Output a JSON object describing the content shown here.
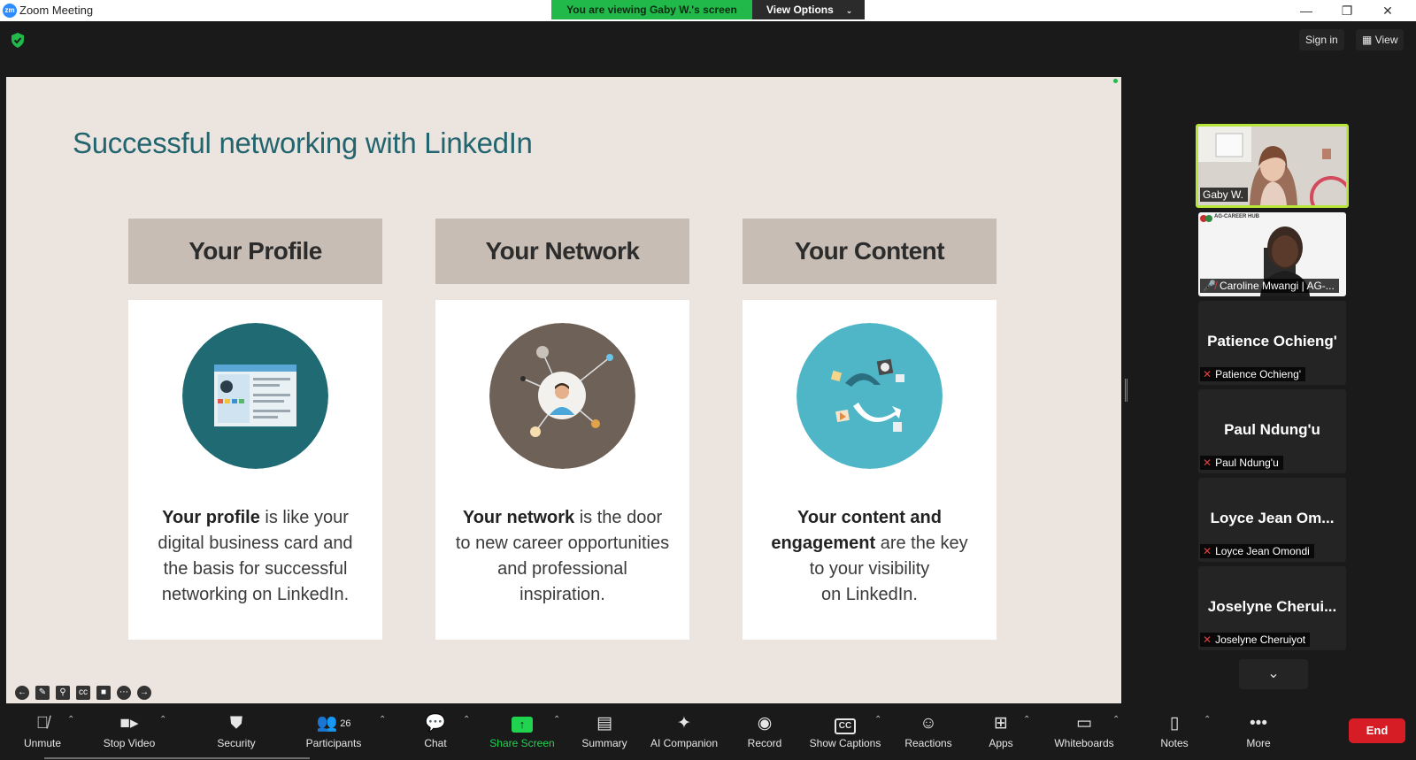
{
  "window": {
    "title": "Zoom Meeting",
    "logo_text": "zm",
    "controls": [
      "—",
      "❐",
      "✕"
    ]
  },
  "banner": {
    "viewing": "You are viewing Gaby W.'s screen",
    "options": "View Options"
  },
  "top": {
    "sign_in": "Sign in",
    "view": "View"
  },
  "slide": {
    "title": "Successful networking with LinkedIn",
    "columns": [
      {
        "header": "Your Profile",
        "bold": "Your profile",
        "rest_1": " is like your",
        "line2": "digital business card and",
        "line3": "the basis for successful",
        "line4": "networking on LinkedIn.",
        "circle_color": "#1f6a73"
      },
      {
        "header": "Your Network",
        "bold": "Your network",
        "rest_1": " is the door",
        "line2": "to new career opportunities",
        "line3": "and professional",
        "line4": "inspiration.",
        "circle_color": "#6e6157"
      },
      {
        "header": "Your Content",
        "bold_a": "Your content and",
        "bold_b": "engagement",
        "rest_b": " are the key",
        "line3": "to your visibility",
        "line4": "on LinkedIn.",
        "circle_color": "#4fb6c8"
      }
    ]
  },
  "gallery": {
    "tiles": [
      {
        "label": "Gaby W.",
        "video": true,
        "active": true
      },
      {
        "label": "Caroline Mwangi | AG-...",
        "video": true,
        "muted": true,
        "org_text": "AG-CAREER HUB"
      },
      {
        "center": "Patience Ochieng'",
        "label": "Patience Ochieng'",
        "muted": true
      },
      {
        "center": "Paul Ndung'u",
        "label": "Paul Ndung'u",
        "muted": true
      },
      {
        "center": "Loyce Jean Om...",
        "label": "Loyce Jean Omondi",
        "muted": true
      },
      {
        "center": "Joselyne Cherui...",
        "label": "Joselyne Cheruiyot",
        "muted": true
      }
    ]
  },
  "toolbar": {
    "unmute": "Unmute",
    "stop_video": "Stop Video",
    "security": "Security",
    "participants": "Participants",
    "participants_count": "26",
    "chat": "Chat",
    "share_screen": "Share Screen",
    "summary": "Summary",
    "ai_companion": "AI Companion",
    "record": "Record",
    "show_captions": "Show Captions",
    "reactions": "Reactions",
    "apps": "Apps",
    "whiteboards": "Whiteboards",
    "notes": "Notes",
    "more": "More",
    "end": "End"
  },
  "colors": {
    "accent_green": "#21b94a",
    "end_red": "#d61c24",
    "slide_title": "#22656f"
  }
}
